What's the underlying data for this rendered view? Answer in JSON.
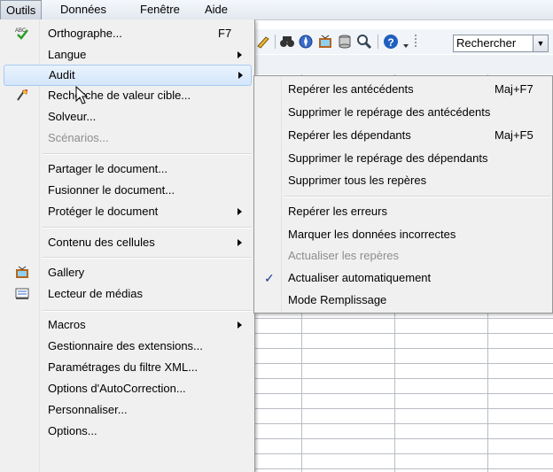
{
  "menubar": {
    "items": [
      {
        "label": "Outils"
      },
      {
        "label": "Données"
      },
      {
        "label": "Fenêtre"
      },
      {
        "label": "Aide"
      }
    ]
  },
  "toolbar": {
    "search_value": "Rechercher"
  },
  "menu": {
    "items": [
      {
        "label": "Orthographe...",
        "shortcut": "F7",
        "icon": "spellcheck-icon"
      },
      {
        "label": "Langue"
      },
      {
        "label": "Audit"
      },
      {
        "label": "Recherche de valeur cible...",
        "icon": "goal-seek-icon"
      },
      {
        "label": "Solveur..."
      },
      {
        "label": "Scénarios..."
      },
      {
        "label": "Partager le document..."
      },
      {
        "label": "Fusionner le document..."
      },
      {
        "label": "Protéger le document"
      },
      {
        "label": "Contenu des cellules"
      },
      {
        "label": "Gallery",
        "icon": "gallery-icon"
      },
      {
        "label": "Lecteur de médias",
        "icon": "media-player-icon"
      },
      {
        "label": "Macros"
      },
      {
        "label": "Gestionnaire des extensions..."
      },
      {
        "label": "Paramétrages du filtre XML..."
      },
      {
        "label": "Options d'AutoCorrection..."
      },
      {
        "label": "Personnaliser..."
      },
      {
        "label": "Options..."
      }
    ]
  },
  "submenu": {
    "items": [
      {
        "label": "Repérer les antécédents",
        "shortcut": "Maj+F7"
      },
      {
        "label": "Supprimer le repérage des antécédents"
      },
      {
        "label": "Repérer les dépendants",
        "shortcut": "Maj+F5"
      },
      {
        "label": "Supprimer le repérage des dépendants"
      },
      {
        "label": "Supprimer tous les repères"
      },
      {
        "label": "Repérer les erreurs"
      },
      {
        "label": "Marquer les données incorrectes"
      },
      {
        "label": "Actualiser les repères"
      },
      {
        "label": "Actualiser automatiquement",
        "check": "✓"
      },
      {
        "label": "Mode Remplissage"
      }
    ]
  }
}
